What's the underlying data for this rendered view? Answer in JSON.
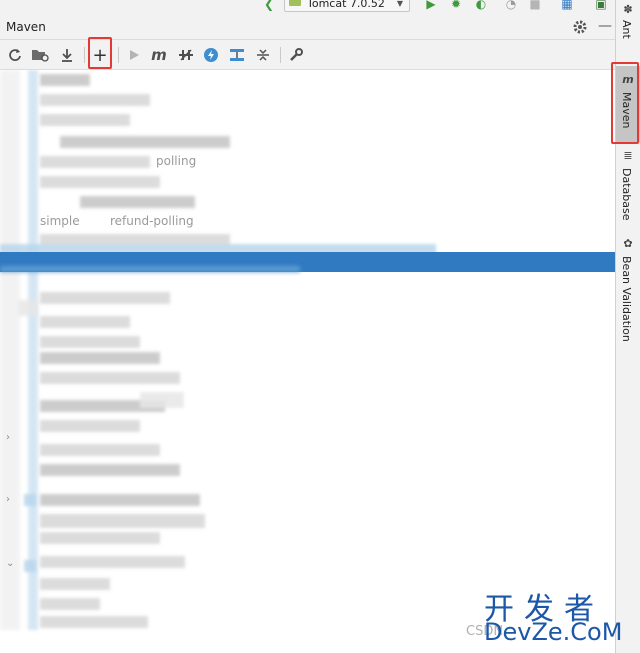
{
  "top_bar": {
    "run_config_label": "Tomcat 7.0.52"
  },
  "tool_window": {
    "title": "Maven"
  },
  "toolbar": {
    "buttons": [
      {
        "name": "reload-all-projects",
        "icon": "reload-icon"
      },
      {
        "name": "generate-sources",
        "icon": "folder-reload-icon"
      },
      {
        "name": "download-sources",
        "icon": "download-icon"
      },
      {
        "name": "add-maven-project",
        "icon": "plus-icon",
        "label": "+"
      },
      {
        "name": "run-maven-build",
        "icon": "play-icon"
      },
      {
        "name": "execute-maven-goal",
        "icon": "maven-m-icon",
        "label": "m"
      },
      {
        "name": "toggle-offline-mode",
        "icon": "offline-icon"
      },
      {
        "name": "skip-tests",
        "icon": "lightning-icon"
      },
      {
        "name": "show-dependencies",
        "icon": "diagram-icon"
      },
      {
        "name": "collapse-all",
        "icon": "collapse-icon"
      },
      {
        "name": "maven-settings",
        "icon": "wrench-icon"
      }
    ]
  },
  "tree": {
    "visible_texts": [
      "polling",
      "simple",
      "refund-polling"
    ]
  },
  "right_stripe": {
    "tabs": [
      {
        "label": "Ant",
        "icon": "ant-icon"
      },
      {
        "label": "Maven",
        "icon": "maven-m-icon",
        "active": true
      },
      {
        "label": "Database",
        "icon": "database-icon"
      },
      {
        "label": "Bean Validation",
        "icon": "bean-validation-icon"
      }
    ]
  },
  "watermark": {
    "cn": "开发者",
    "en": "DevZe.CoM",
    "csdn": "CSDN"
  },
  "colors": {
    "selection": "#2f7ac1",
    "annotation_red": "#e53935",
    "watermark_blue": "#1c57a8"
  }
}
